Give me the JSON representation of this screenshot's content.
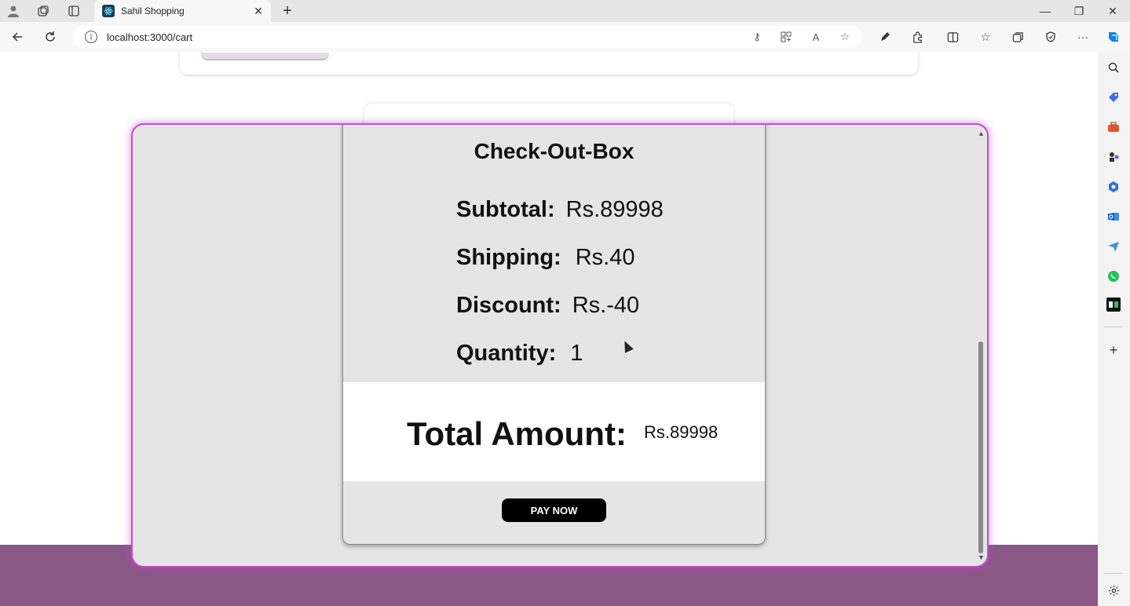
{
  "browser": {
    "tab_title": "Sahil Shopping",
    "tab_close": "✕",
    "new_tab": "+",
    "url": "localhost:3000/cart",
    "info_icon": "i",
    "window_controls": {
      "minimize": "—",
      "restore": "❐",
      "close": "✕"
    }
  },
  "checkout": {
    "title": "Check-Out-Box",
    "subtotal_label": "Subtotal:",
    "subtotal_value": "Rs.89998",
    "shipping_label": "Shipping:",
    "shipping_value": "Rs.40",
    "discount_label": "Discount:",
    "discount_value": "Rs.-40",
    "quantity_label": "Quantity:",
    "quantity_value": "1",
    "total_label": "Total Amount:",
    "total_value": "Rs.89998",
    "pay_button": "PAY NOW"
  },
  "colors": {
    "footer": "#8a5886",
    "modal_glow": "#c44ccc",
    "modal_bg": "#e4e5e4",
    "pay_button_bg": "#000000"
  }
}
